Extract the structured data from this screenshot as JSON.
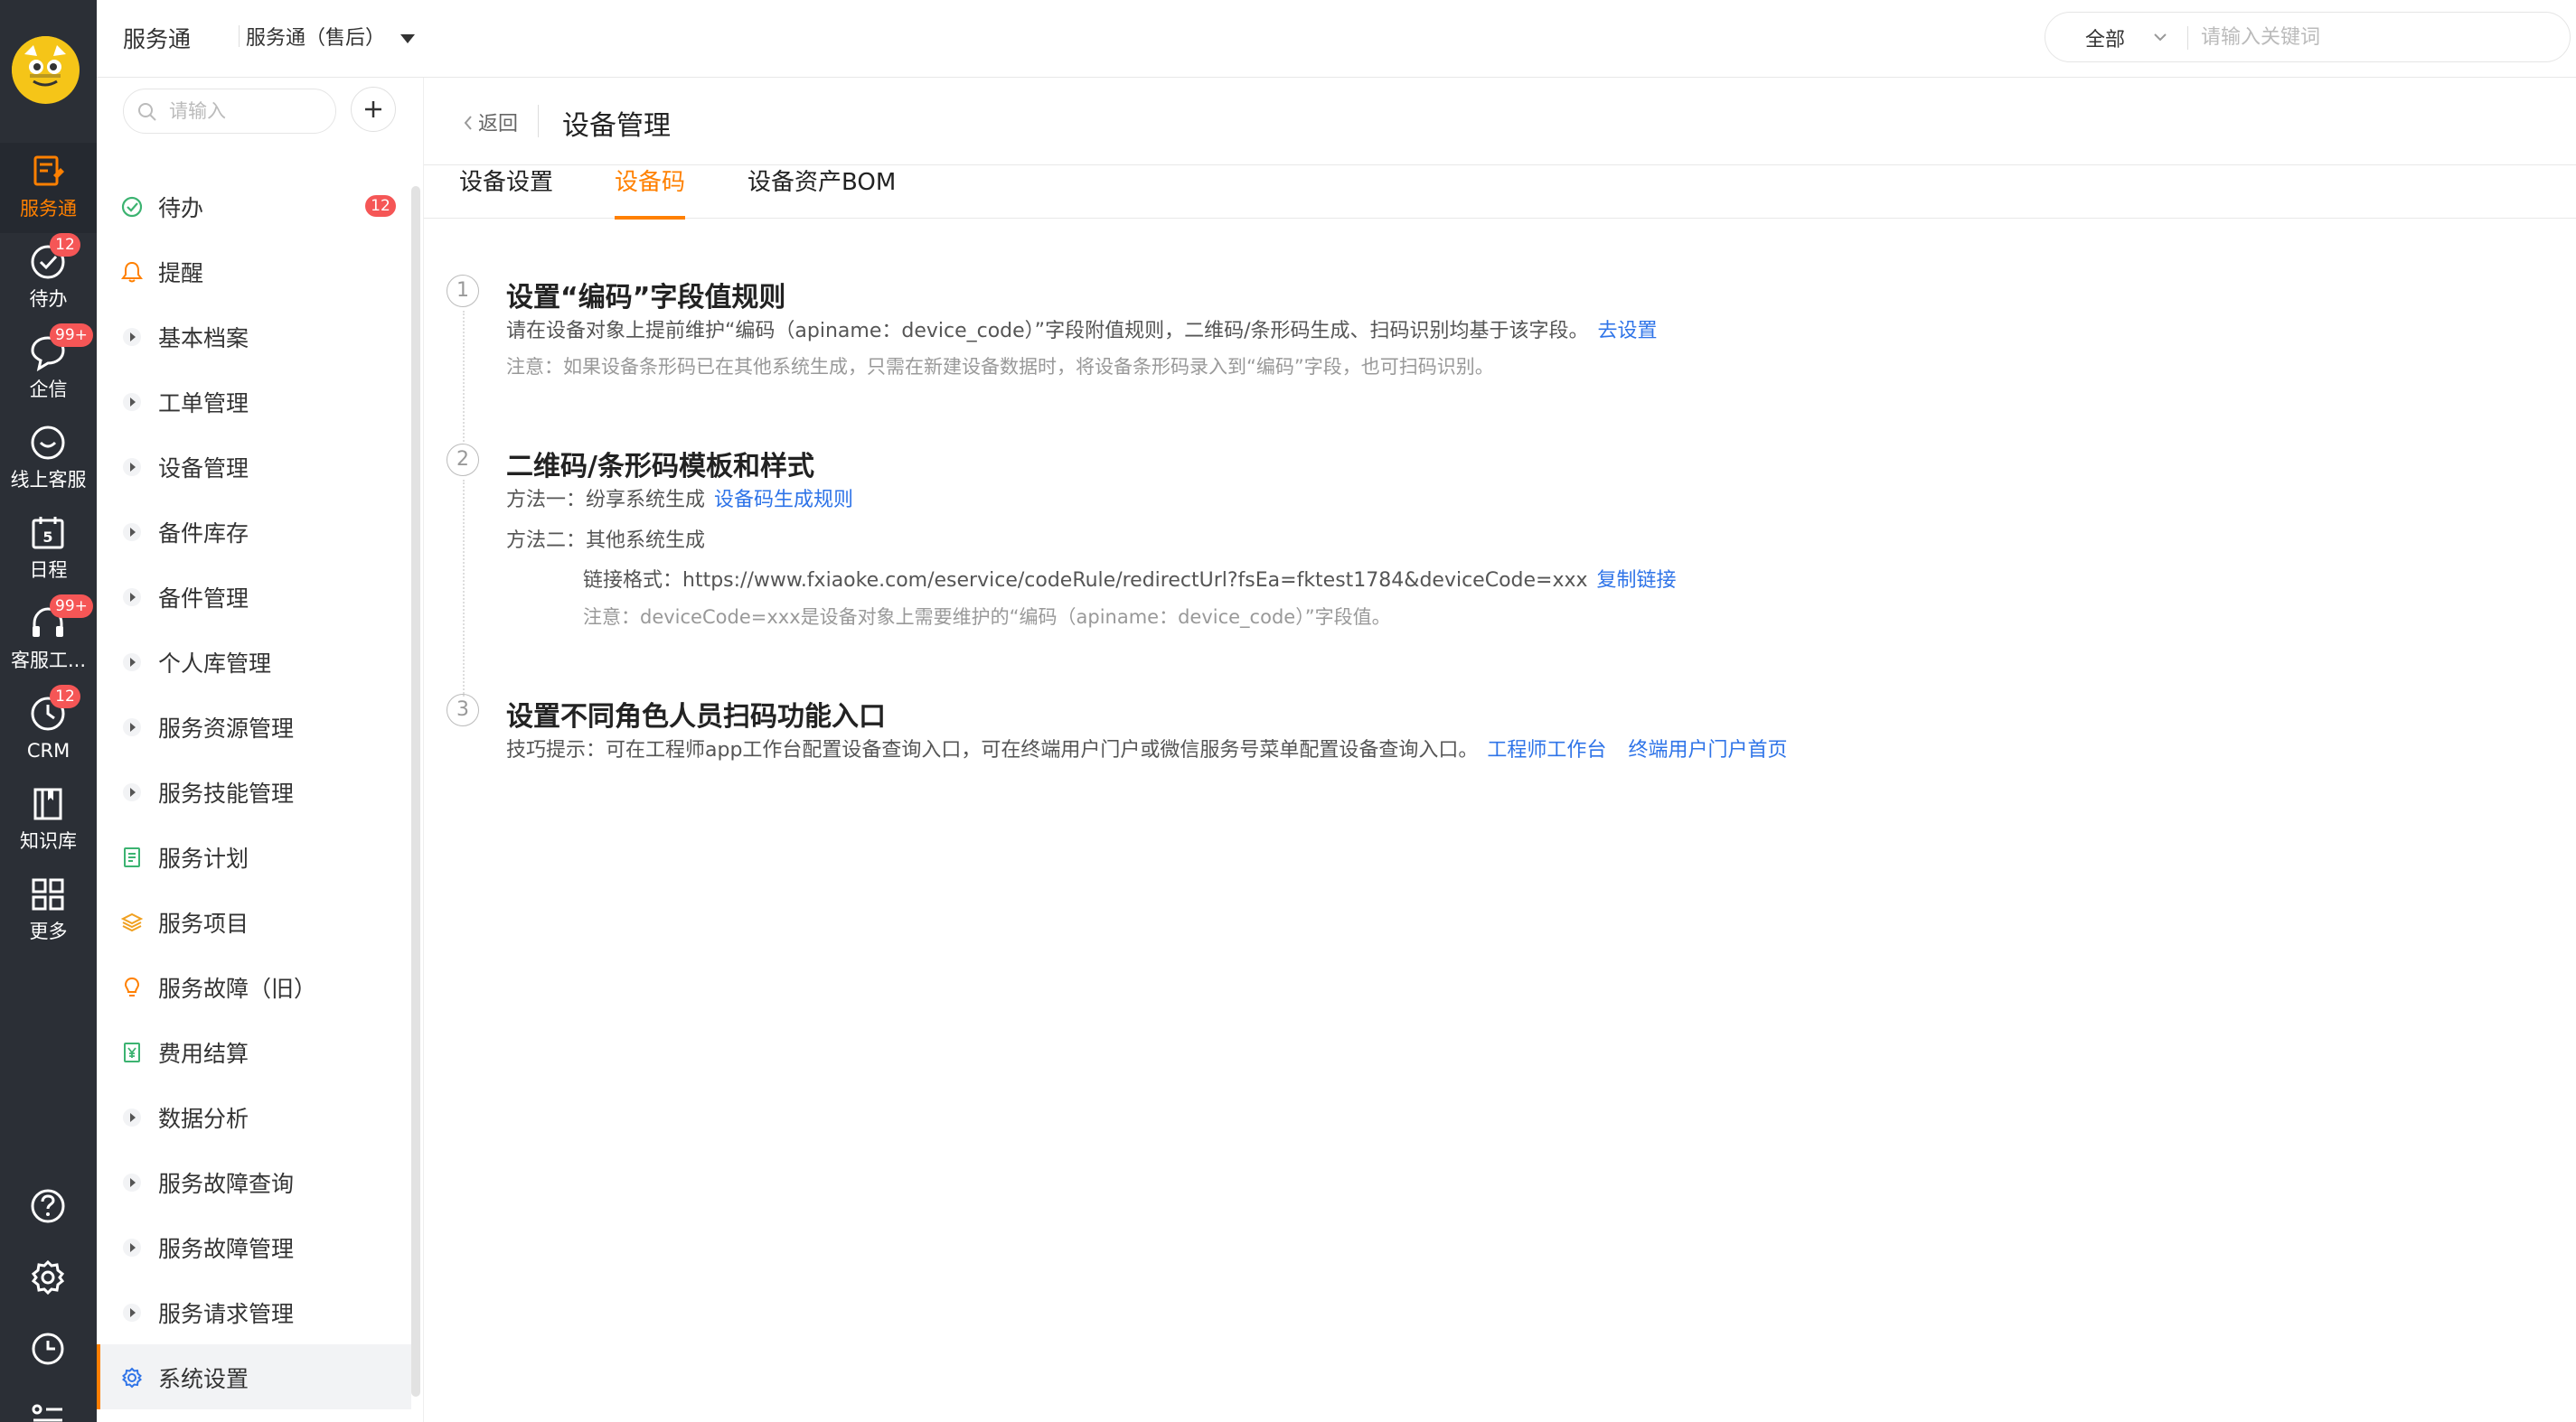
{
  "rail": {
    "items": [
      {
        "label": "服务通",
        "icon": "service-icon",
        "active": true
      },
      {
        "label": "待办",
        "icon": "check-circle-icon",
        "badge": "12"
      },
      {
        "label": "企信",
        "icon": "chat-bubble-icon",
        "badge": "99+"
      },
      {
        "label": "线上客服",
        "icon": "online-service-icon"
      },
      {
        "label": "日程",
        "icon": "calendar-icon",
        "calendar_day": "5"
      },
      {
        "label": "客服工...",
        "icon": "headset-icon",
        "badge": "99+"
      },
      {
        "label": "CRM",
        "icon": "clock-icon",
        "badge": "12"
      },
      {
        "label": "知识库",
        "icon": "book-icon"
      },
      {
        "label": "更多",
        "icon": "grid-icon"
      }
    ],
    "bottom_icons": [
      "help-icon",
      "settings-icon",
      "history-icon",
      "list-icon"
    ]
  },
  "topbar": {
    "app_name": "服务通",
    "app_switch": "服务通（售后）",
    "search_scope": "全部",
    "search_placeholder": "请输入关键词"
  },
  "sidebar": {
    "search_placeholder": "请输入",
    "items": [
      {
        "label": "待办",
        "icon": "check-circle-icon",
        "badge": "12"
      },
      {
        "label": "提醒",
        "icon": "bell-icon"
      },
      {
        "label": "基本档案",
        "icon": "caret-right-icon"
      },
      {
        "label": "工单管理",
        "icon": "caret-right-icon"
      },
      {
        "label": "设备管理",
        "icon": "caret-right-icon"
      },
      {
        "label": "备件库存",
        "icon": "caret-right-icon"
      },
      {
        "label": "备件管理",
        "icon": "caret-right-icon"
      },
      {
        "label": "个人库管理",
        "icon": "caret-right-icon"
      },
      {
        "label": "服务资源管理",
        "icon": "caret-right-icon"
      },
      {
        "label": "服务技能管理",
        "icon": "caret-right-icon"
      },
      {
        "label": "服务计划",
        "icon": "document-icon"
      },
      {
        "label": "服务项目",
        "icon": "layers-icon"
      },
      {
        "label": "服务故障（旧）",
        "icon": "bulb-icon"
      },
      {
        "label": "费用结算",
        "icon": "yen-receipt-icon"
      },
      {
        "label": "数据分析",
        "icon": "caret-right-icon"
      },
      {
        "label": "服务故障查询",
        "icon": "caret-right-icon"
      },
      {
        "label": "服务故障管理",
        "icon": "caret-right-icon"
      },
      {
        "label": "服务请求管理",
        "icon": "caret-right-icon"
      },
      {
        "label": "系统设置",
        "icon": "gear-icon",
        "active": true
      }
    ]
  },
  "colors": {
    "accent": "#ff8000",
    "link": "#2f74e8",
    "badge": "#f55656",
    "rail": "#2b2f36"
  },
  "main": {
    "back_label": "返回",
    "title": "设备管理",
    "tabs": [
      {
        "label": "设备设置"
      },
      {
        "label": "设备码",
        "active": true
      },
      {
        "label": "设备资产BOM"
      }
    ],
    "steps": [
      {
        "num": "1",
        "title": "设置“编码”字段值规则",
        "desc": "请在设备对象上提前维护“编码（apiname：device_code）”字段附值规则，二维码/条形码生成、扫码识别均基于该字段。",
        "desc_link": "去设置",
        "note": "注意：如果设备条形码已在其他系统生成，只需在新建设备数据时，将设备条形码录入到“编码”字段，也可扫码识别。"
      },
      {
        "num": "2",
        "title": "二维码/条形码模板和样式",
        "method1": "方法一：纷享系统生成",
        "method1_link": "设备码生成规则",
        "method2": "方法二：其他系统生成",
        "link_format": "链接格式：https://www.fxiaoke.com/eservice/codeRule/redirectUrl?fsEa=fktest1784&deviceCode=xxx",
        "copy_link": "复制链接",
        "note": "注意：deviceCode=xxx是设备对象上需要维护的“编码（apiname：device_code）”字段值。"
      },
      {
        "num": "3",
        "title": "设置不同角色人员扫码功能入口",
        "tip": "技巧提示：可在工程师app工作台配置设备查询入口，可在终端用户门户或微信服务号菜单配置设备查询入口。",
        "link1": "工程师工作台",
        "link2": "终端用户门户首页"
      }
    ]
  }
}
